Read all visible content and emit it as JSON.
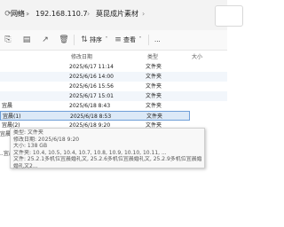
{
  "address": {
    "crumbs": [
      "网络",
      "192.168.110.7",
      "莫昆成片素材"
    ]
  },
  "toolbar": {
    "sort_label": "排序",
    "view_label": "查看",
    "more_label": "..."
  },
  "columns": {
    "date": "修改日期",
    "type": "类型",
    "size": "大小"
  },
  "rows": [
    {
      "name": "",
      "date": "2025/6/17 11:14",
      "type": "文件夹"
    },
    {
      "name": "",
      "date": "2025/6/16 14:00",
      "type": "文件夹"
    },
    {
      "name": "",
      "date": "2025/6/16 15:56",
      "type": "文件夹"
    },
    {
      "name": "",
      "date": "2025/6/17 15:01",
      "type": "文件夹"
    },
    {
      "name": "宜晨",
      "date": "2025/6/18 8:43",
      "type": "文件夹"
    },
    {
      "name": "宜晨(1)",
      "date": "2025/6/18 8:53",
      "type": "文件夹"
    },
    {
      "name": "宜晨(2)",
      "date": "2025/6/18 9:20",
      "type": "文件夹"
    }
  ],
  "side_labels": [
    "宜晨",
    "..宜晨"
  ],
  "tooltip": {
    "lines": [
      "类型: 文件夹",
      "修改日期: 2025/6/18 9:20",
      "大小: 138 GB",
      "文件夹: 10.4, 10.5, 10.4, 10.7, 10.8, 10.9, 10.10, 10.11, ...",
      "文件: 25.2.1多机位宜晨婚礼文, 25.2.6多机位宜晨婚礼文, 25.2.9多机位宜晨婚礼文,..."
    ],
    "extra_line": "婚礼文2..."
  }
}
